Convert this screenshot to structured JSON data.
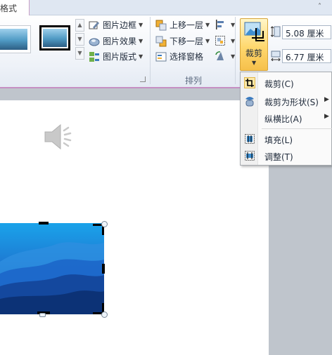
{
  "tabs": {
    "active": "格式"
  },
  "ribbon": {
    "picture_commands": [
      {
        "label": "图片边框",
        "icon": "picture-border-icon"
      },
      {
        "label": "图片效果",
        "icon": "picture-effects-icon"
      },
      {
        "label": "图片版式",
        "icon": "picture-layout-icon"
      }
    ],
    "arrange": {
      "group_label": "排列",
      "commands": [
        {
          "label": "上移一层",
          "icon": "bring-forward-icon"
        },
        {
          "label": "下移一层",
          "icon": "send-backward-icon"
        },
        {
          "label": "选择窗格",
          "icon": "selection-pane-icon"
        }
      ]
    },
    "crop": {
      "label": "裁剪",
      "icon": "crop-icon"
    },
    "size": {
      "height": "5.08 厘米",
      "width": "6.77 厘米"
    }
  },
  "crop_menu": {
    "items": [
      {
        "label": "裁剪(C)",
        "icon": "crop-icon",
        "submenu": false
      },
      {
        "label": "裁剪为形状(S)",
        "icon": "crop-to-shape-icon",
        "submenu": true
      },
      {
        "label": "纵横比(A)",
        "icon": "",
        "submenu": true
      },
      {
        "label": "填充(L)",
        "icon": "fill-icon",
        "submenu": false
      },
      {
        "label": "调整(T)",
        "icon": "fit-icon",
        "submenu": false
      }
    ]
  },
  "colors": {
    "ribbon_accent": "#c58fc3",
    "crop_button": "#ffd86e",
    "picture_blue": "#1e79d2"
  }
}
